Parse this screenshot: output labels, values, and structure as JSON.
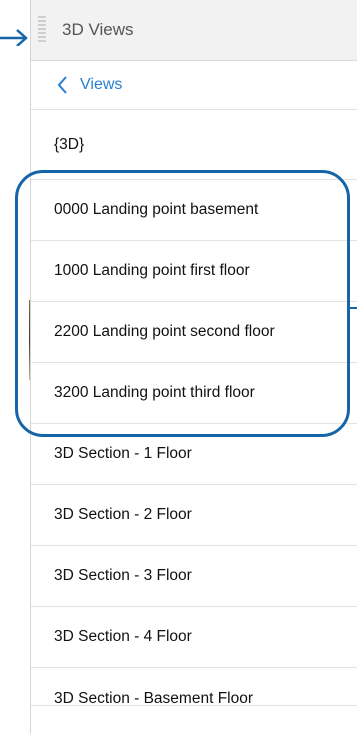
{
  "panel": {
    "title": "3D Views",
    "back_label": "Views"
  },
  "views": [
    {
      "label": "{3D}"
    },
    {
      "label": "0000 Landing point basement"
    },
    {
      "label": "1000 Landing point first floor"
    },
    {
      "label": "2200 Landing point second floor"
    },
    {
      "label": "3200 Landing point third floor"
    },
    {
      "label": "3D Section - 1 Floor"
    },
    {
      "label": "3D Section - 2 Floor"
    },
    {
      "label": "3D Section - 3 Floor"
    },
    {
      "label": "3D Section - 4 Floor"
    },
    {
      "label": "3D Section - Basement Floor"
    }
  ],
  "colors": {
    "accent": "#2a7fd1",
    "highlight": "#1565a8"
  },
  "icons": {
    "back": "chevron-left-icon",
    "pointer": "arrow-right-icon",
    "grip": "drag-handle-icon"
  }
}
